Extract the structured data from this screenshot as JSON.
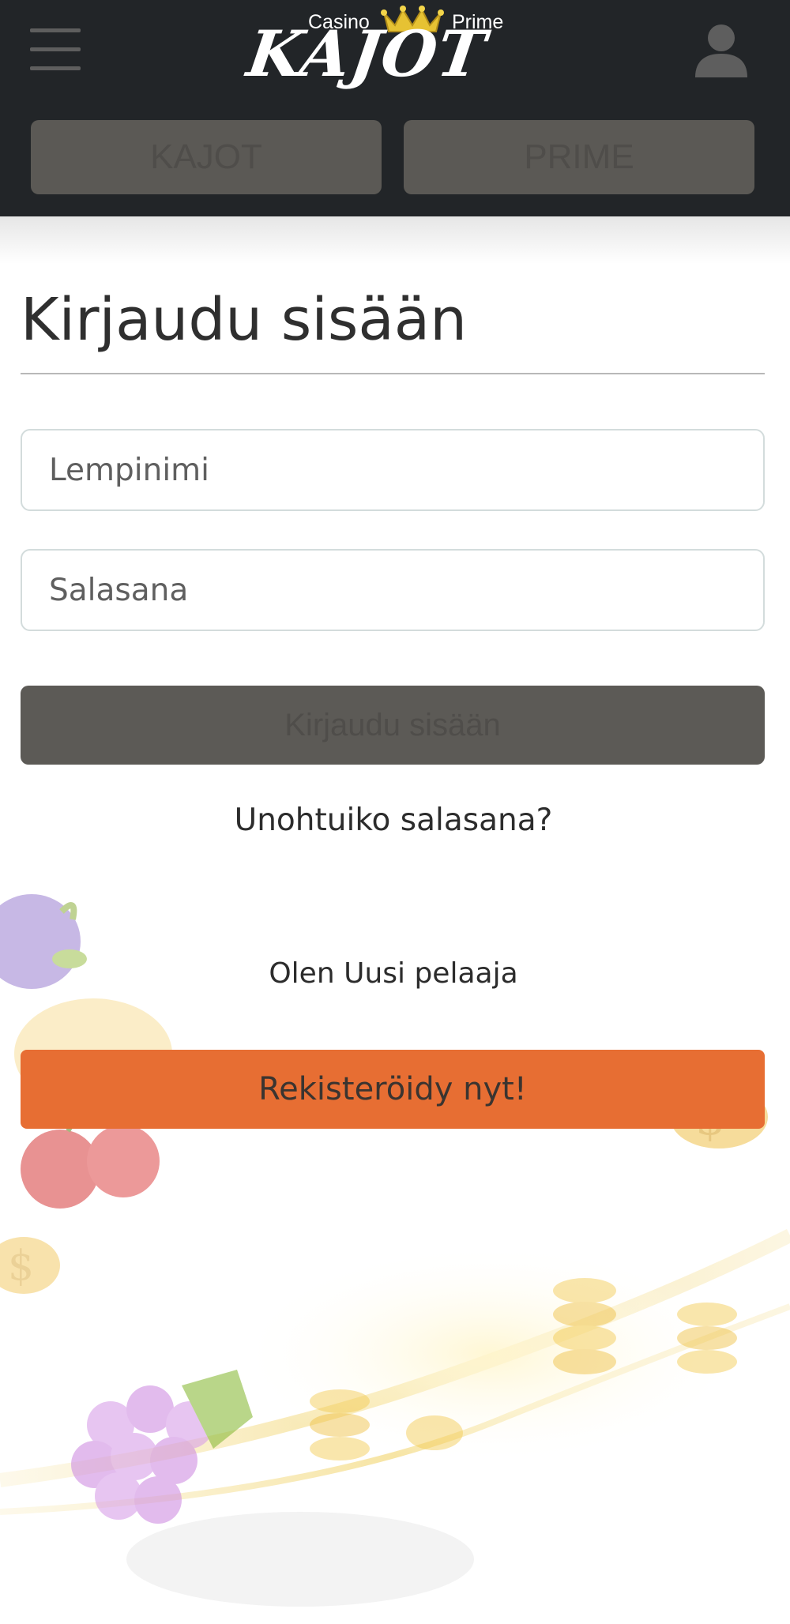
{
  "header": {
    "logo": {
      "small_left": "Casino",
      "small_right": "Prime",
      "main": "KAJOT"
    },
    "switch": [
      {
        "label": "KAJOT"
      },
      {
        "label": "PRIME"
      }
    ]
  },
  "login": {
    "title": "Kirjaudu sisään",
    "nickname_placeholder": "Lempinimi",
    "password_placeholder": "Salasana",
    "submit_label": "Kirjaudu sisään",
    "forgot_label": "Unohtuiko salasana?"
  },
  "register": {
    "prompt": "Olen Uusi pelaaja",
    "button_label": "Rekisteröidy nyt!"
  },
  "colors": {
    "header_bg": "#222528",
    "switch_bg": "#5b5955",
    "login_button_bg": "#5c5a56",
    "register_button_bg": "#e76e33"
  },
  "icons": [
    "hamburger-menu-icon",
    "crown-icon",
    "user-icon"
  ]
}
